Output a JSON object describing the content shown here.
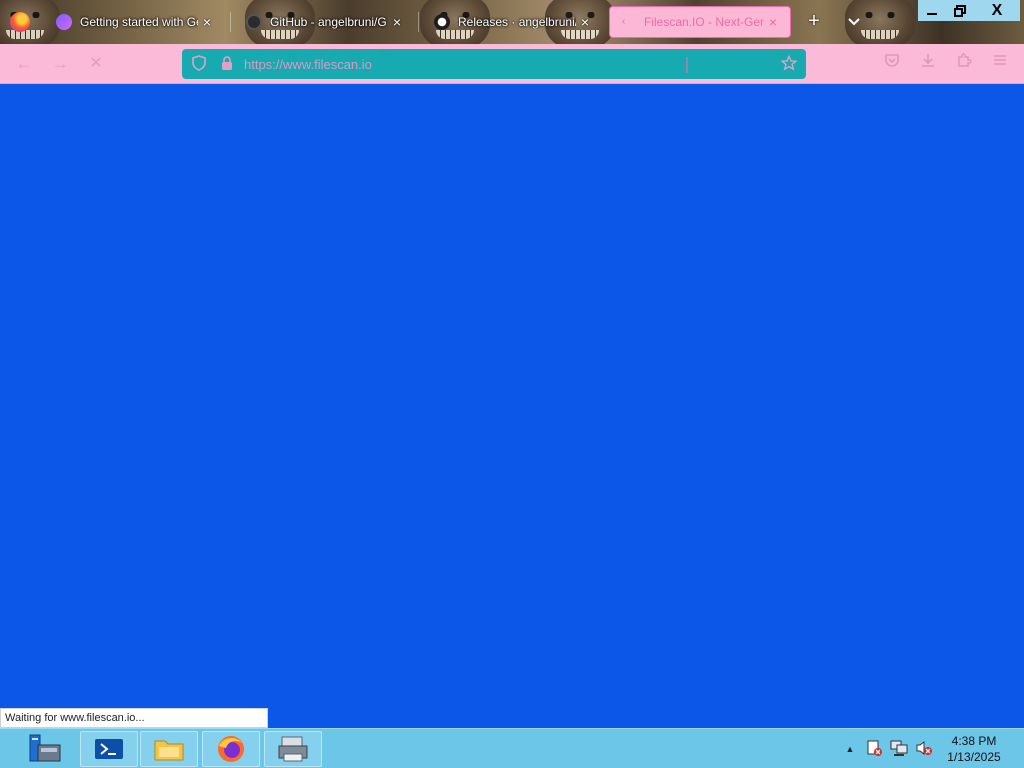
{
  "browser": {
    "tabs": [
      {
        "title": "Getting started with Ge",
        "close_icon": "×",
        "active": false
      },
      {
        "title": "GitHub - angelbruni/G",
        "close_icon": "×",
        "active": false
      },
      {
        "title": "Releases · angelbruni/G",
        "close_icon": "×",
        "active": false
      },
      {
        "title": "Filescan.IO - Next-Gen I",
        "close_icon": "×",
        "active": true
      }
    ],
    "new_tab_label": "+",
    "tab_list_label": "⌄",
    "window_controls": {
      "minimize": "—",
      "maximize": "❐",
      "close": "X"
    },
    "nav": {
      "back": "←",
      "forward": "→",
      "stop": "✕"
    },
    "urlbar": {
      "url": "https://www.filescan.io"
    },
    "status": "Waiting for www.filescan.io..."
  },
  "taskbar": {
    "clock": {
      "time": "4:38 PM",
      "date": "1/13/2025"
    },
    "tray_expand": "▲"
  },
  "colors": {
    "page_background": "#0d57e8",
    "navbar": "#fbbbd8",
    "urlbar": "#18aab1",
    "active_tab": "#fbb8d6",
    "taskbar": "#6bc6e8"
  },
  "icons": {
    "firefox": "firefox-icon",
    "tracking_protection": "shield-icon",
    "lock": "lock-icon",
    "bookmark": "star-icon",
    "pocket": "pocket-icon",
    "downloads": "download-icon",
    "extensions": "puzzle-icon",
    "menu": "hamburger-icon"
  }
}
